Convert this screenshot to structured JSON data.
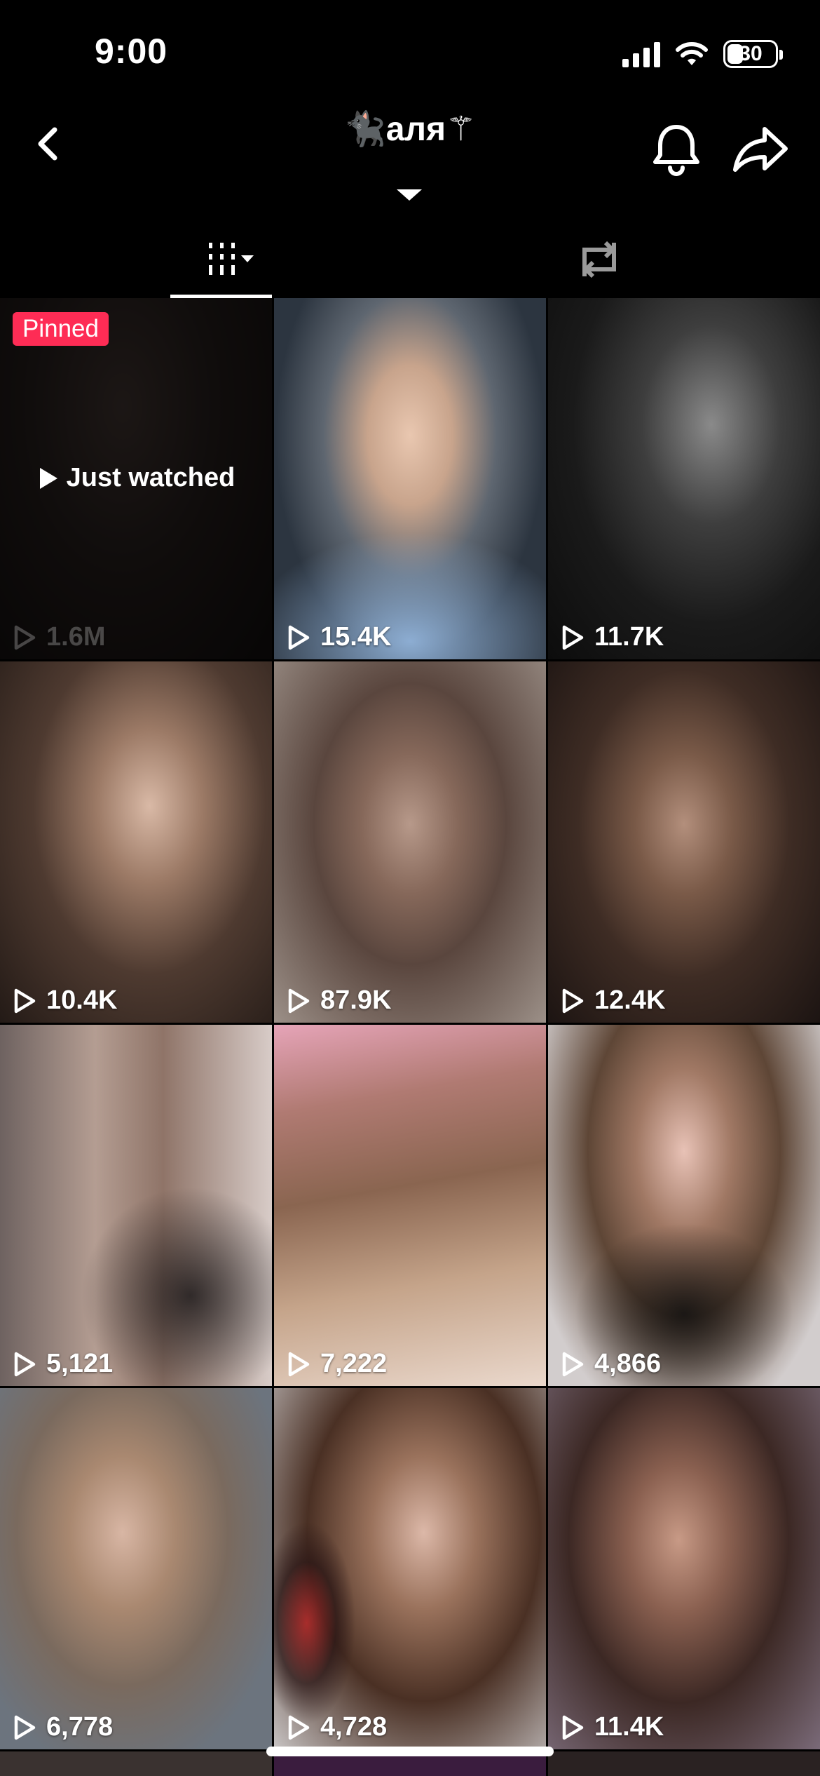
{
  "status_bar": {
    "time": "9:00",
    "battery_percent": "30",
    "icons": [
      "signal-icon",
      "wifi-icon",
      "battery-icon"
    ]
  },
  "nav": {
    "title": "🐈‍⬛аля⚚",
    "icons": [
      "chevron-left-icon",
      "bell-icon",
      "share-icon",
      "caret-down-icon"
    ]
  },
  "tabs": [
    {
      "name": "videos-grid",
      "icon": "grid-filter-icon",
      "active": true
    },
    {
      "name": "reposts",
      "icon": "repost-icon",
      "active": false
    }
  ],
  "videos": [
    {
      "views": "1.6M",
      "pinned_label": "Pinned",
      "overlay_label": "Just watched"
    },
    {
      "views": "15.4K"
    },
    {
      "views": "11.7K"
    },
    {
      "views": "10.4K"
    },
    {
      "views": "87.9K"
    },
    {
      "views": "12.4K"
    },
    {
      "views": "5,121"
    },
    {
      "views": "7,222"
    },
    {
      "views": "4,866"
    },
    {
      "views": "6,778"
    },
    {
      "views": "4,728"
    },
    {
      "views": "11.4K"
    }
  ],
  "colors": {
    "background": "#000000",
    "pinned_badge": "#fe2c55",
    "text": "#ffffff"
  }
}
